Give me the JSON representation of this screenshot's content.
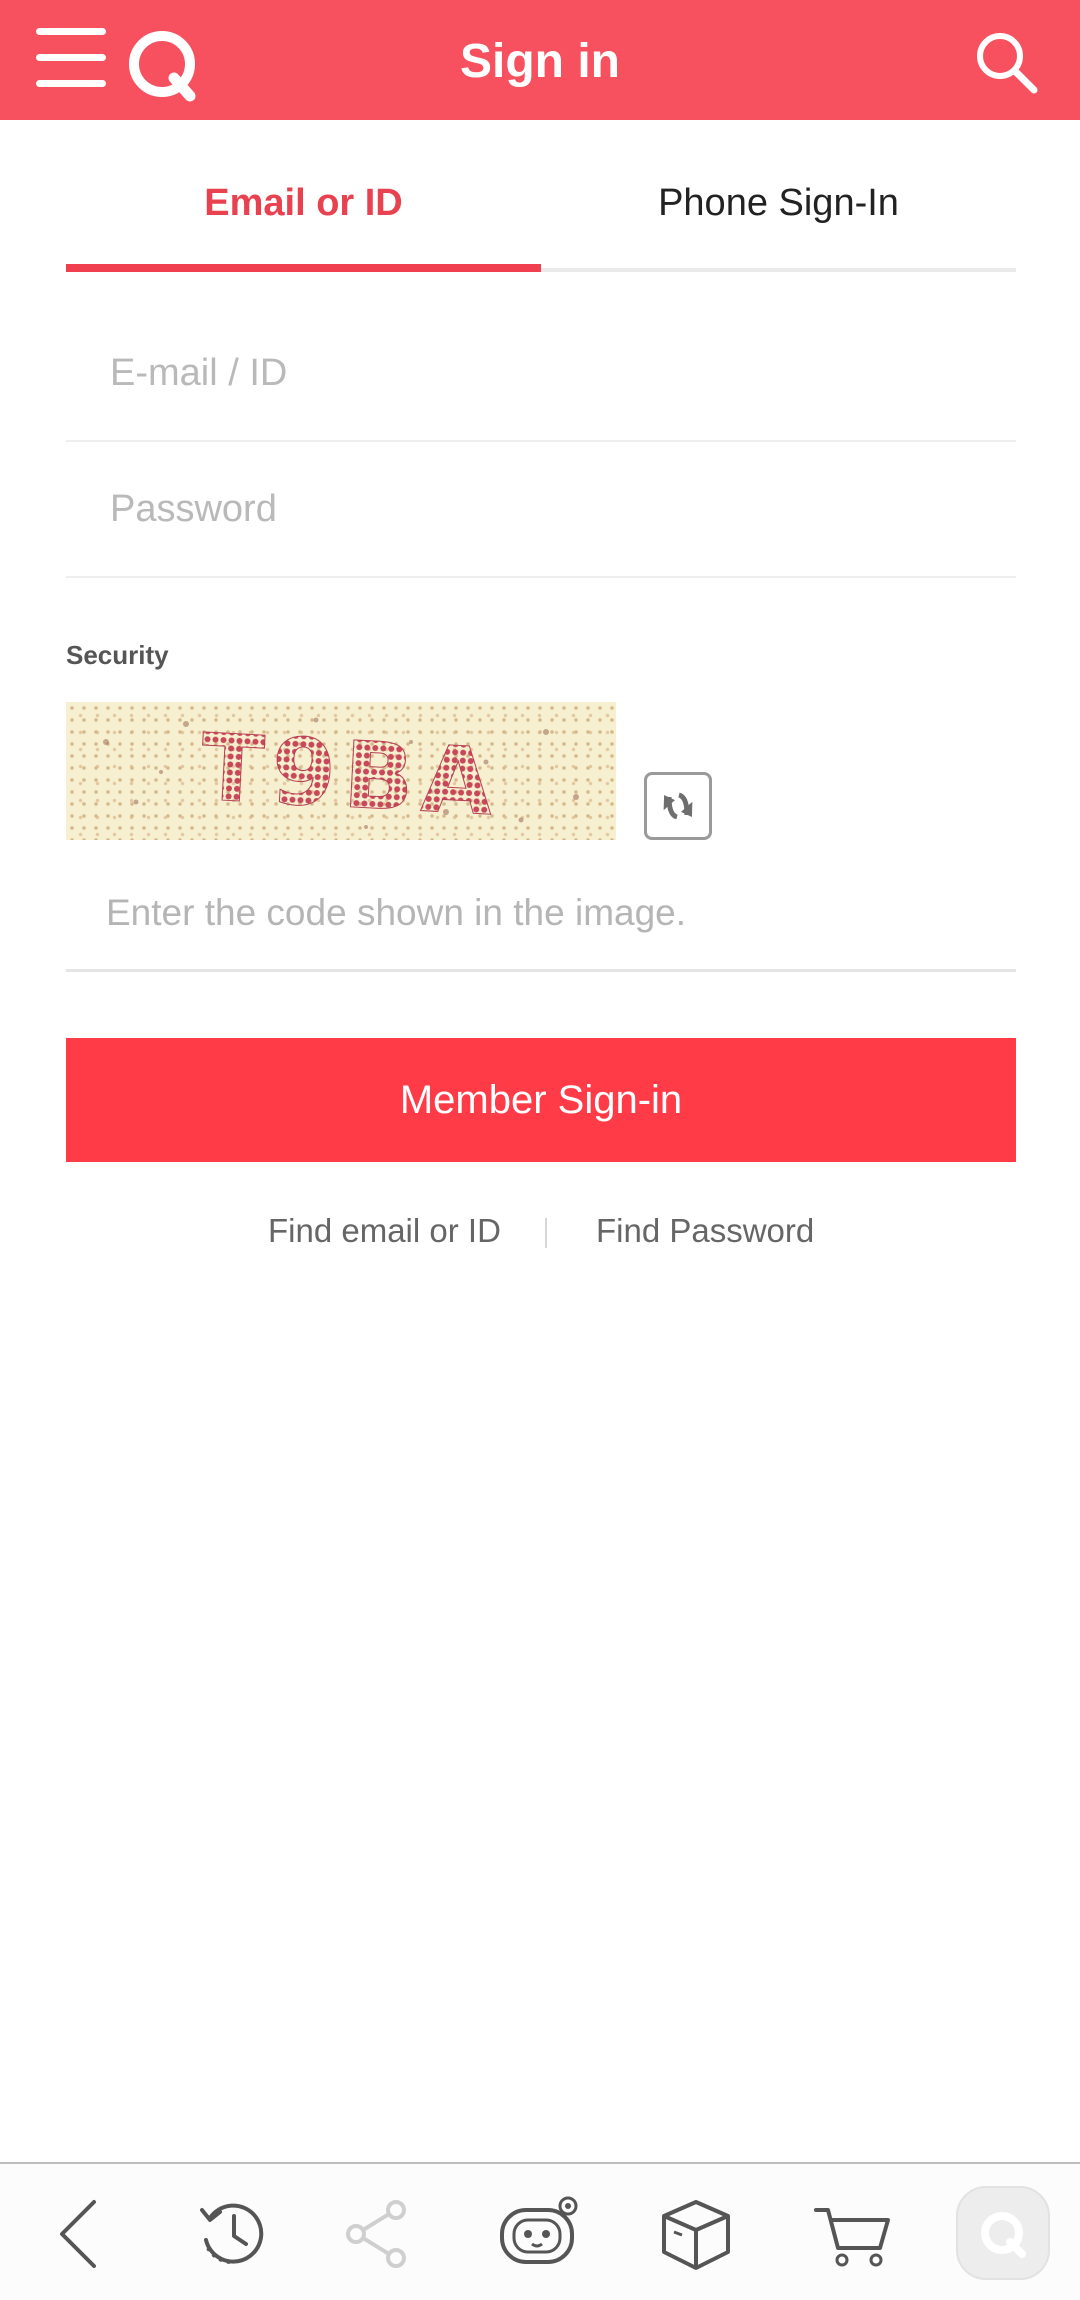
{
  "header": {
    "title": "Sign in",
    "brand_color": "#f7505f",
    "icons": [
      "menu-icon",
      "qoo10-logo-icon",
      "search-icon"
    ]
  },
  "tabs": [
    {
      "label": "Email or ID",
      "active": true
    },
    {
      "label": "Phone Sign-In",
      "active": false
    }
  ],
  "form": {
    "email_placeholder": "E-mail / ID",
    "email_value": "",
    "password_placeholder": "Password",
    "password_value": "",
    "security_label": "Security",
    "captcha_text": "T9BA",
    "code_placeholder": "Enter the code shown in the image.",
    "code_value": "",
    "submit_label": "Member Sign-in"
  },
  "links": {
    "find_id": "Find email or ID",
    "find_password": "Find Password"
  },
  "bottom_nav": {
    "icons": [
      "back-icon",
      "history-icon",
      "share-icon",
      "chat-bot-icon",
      "package-icon",
      "cart-icon",
      "qoo10-home-icon"
    ]
  },
  "colors": {
    "accent": "#f03f4e",
    "button": "#ff3b47",
    "placeholder": "#b9b9b9"
  }
}
